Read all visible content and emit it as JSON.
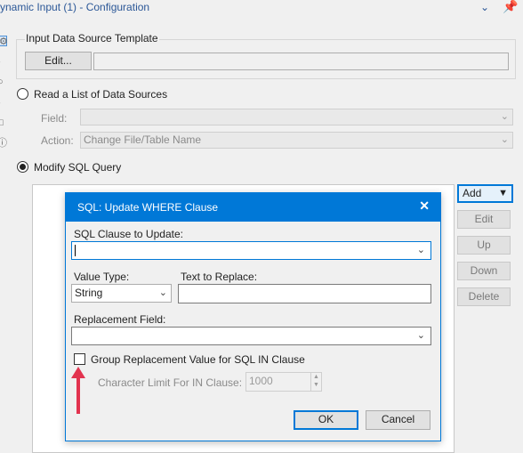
{
  "window": {
    "title": "ynamic Input (1) - Configuration",
    "collapse_icon": "chevron-down-icon",
    "pin_icon": "pin-icon"
  },
  "template_group": {
    "label": "Input Data Source Template",
    "edit_button": "Edit...",
    "template_value": ""
  },
  "read_list": {
    "label": "Read a List of Data Sources",
    "field_label": "Field:",
    "field_value": "",
    "action_label": "Action:",
    "action_value": "Change File/Table Name"
  },
  "modify_sql": {
    "label": "Modify SQL Query",
    "buttons": {
      "add": "Add",
      "edit": "Edit",
      "up": "Up",
      "down": "Down",
      "delete": "Delete"
    }
  },
  "dialog": {
    "title": "SQL: Update WHERE Clause",
    "close_symbol": "✕",
    "sql_clause_label": "SQL Clause to Update:",
    "sql_clause_value": "",
    "value_type_label": "Value Type:",
    "value_type_value": "String",
    "text_to_replace_label": "Text to Replace:",
    "text_to_replace_value": "",
    "replacement_field_label": "Replacement Field:",
    "replacement_field_value": "",
    "group_checkbox_label": "Group Replacement Value for SQL IN Clause",
    "char_limit_label": "Character Limit For IN Clause:",
    "char_limit_value": "1000",
    "ok": "OK",
    "cancel": "Cancel"
  },
  "colors": {
    "accent": "#0078d7",
    "annotation_arrow": "#e2334f"
  }
}
